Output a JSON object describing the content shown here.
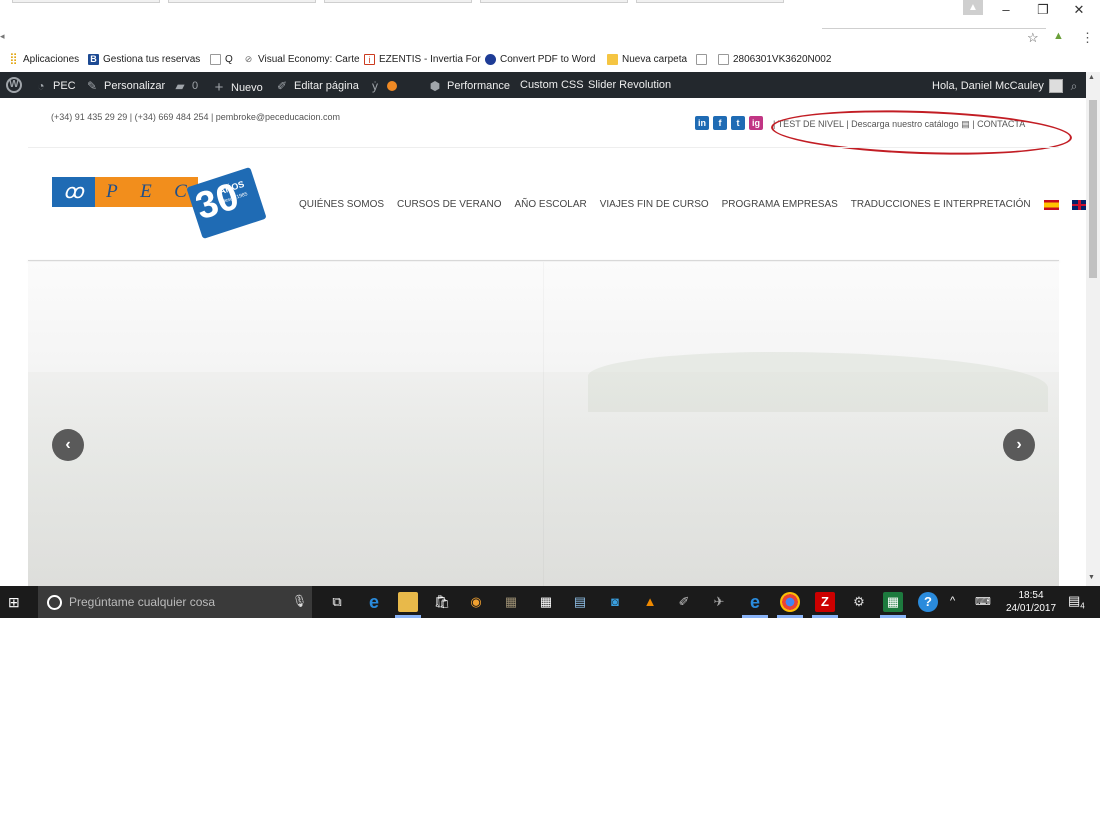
{
  "browser": {
    "window_controls": {
      "minimize": "–",
      "restore": "❐",
      "close": "✕"
    },
    "omnibox_icons": {
      "star": "☆"
    },
    "bookmarks": [
      {
        "icon": "apps-grid-icon",
        "label": "Aplicaciones",
        "color": "#e0a000"
      },
      {
        "icon": "booking-icon",
        "label": "Gestiona tus reservas",
        "color": "#1d4a93"
      },
      {
        "icon": "page-icon",
        "label": "Q",
        "color": "#999999"
      },
      {
        "icon": "visual-economy-icon",
        "label": "Visual Economy: Carte",
        "color": "#6d6d6d"
      },
      {
        "icon": "invertia-icon",
        "label": "EZENTIS - Invertia For",
        "color": "#cc3b1f"
      },
      {
        "icon": "pdf-convert-icon",
        "label": "Convert PDF to Word",
        "color": "#1e3c96"
      },
      {
        "icon": "folder-icon",
        "label": "Nueva carpeta",
        "color": "#f5c542"
      },
      {
        "icon": "page-icon",
        "label": "2806301VK3620N002",
        "color": "#999999"
      }
    ]
  },
  "adminbar": {
    "site": "PEC",
    "customize": "Personalizar",
    "comments": "0",
    "new": "Nuevo",
    "edit_page": "Editar página",
    "performance": "Performance",
    "custom_css": "Custom CSS",
    "slider_revolution": "Slider Revolution",
    "greeting": "Hola, Daniel McCauley"
  },
  "site": {
    "contact_line": "(+34) 91 435 29 29 | (+34) 669 484 254 | pembroke@peceducacion.com",
    "social": [
      {
        "icon": "linkedin-icon",
        "label": "in",
        "color": "#1f6bb4"
      },
      {
        "icon": "facebook-icon",
        "label": "f",
        "color": "#1f6bb4"
      },
      {
        "icon": "twitter-icon",
        "label": "t",
        "color": "#1f6bb4"
      },
      {
        "icon": "instagram-icon",
        "label": "ig",
        "color": "#c13584"
      }
    ],
    "top_links": {
      "separator1": "|",
      "test": "TEST DE NIVEL",
      "separator2": "|",
      "catalog": "Descarga nuestro catálogo",
      "separator3": "|",
      "contact": "CONTACTA"
    },
    "logo": {
      "letters": [
        "P",
        "E",
        "C"
      ],
      "years_big": "30",
      "years_word": "AÑOS",
      "since": "desde 1985"
    },
    "nav": [
      "QUIÉNES SOMOS",
      "CURSOS DE VERANO",
      "AÑO ESCOLAR",
      "VIAJES FIN DE CURSO",
      "PROGRAMA EMPRESAS",
      "TRADUCCIONES E INTERPRETACIÓN"
    ],
    "slider": {
      "prev": "‹",
      "next": "›"
    }
  },
  "taskbar": {
    "search_placeholder": "Pregúntame cualquier cosa",
    "time": "18:54",
    "date": "24/01/2017",
    "notifications": "4"
  },
  "colors": {
    "admin_bar": "#23282d",
    "brand_blue": "#1f6bb4",
    "brand_orange": "#f28e1c",
    "annotation_red": "#c21d24",
    "taskbar": "#1b1b1b"
  }
}
